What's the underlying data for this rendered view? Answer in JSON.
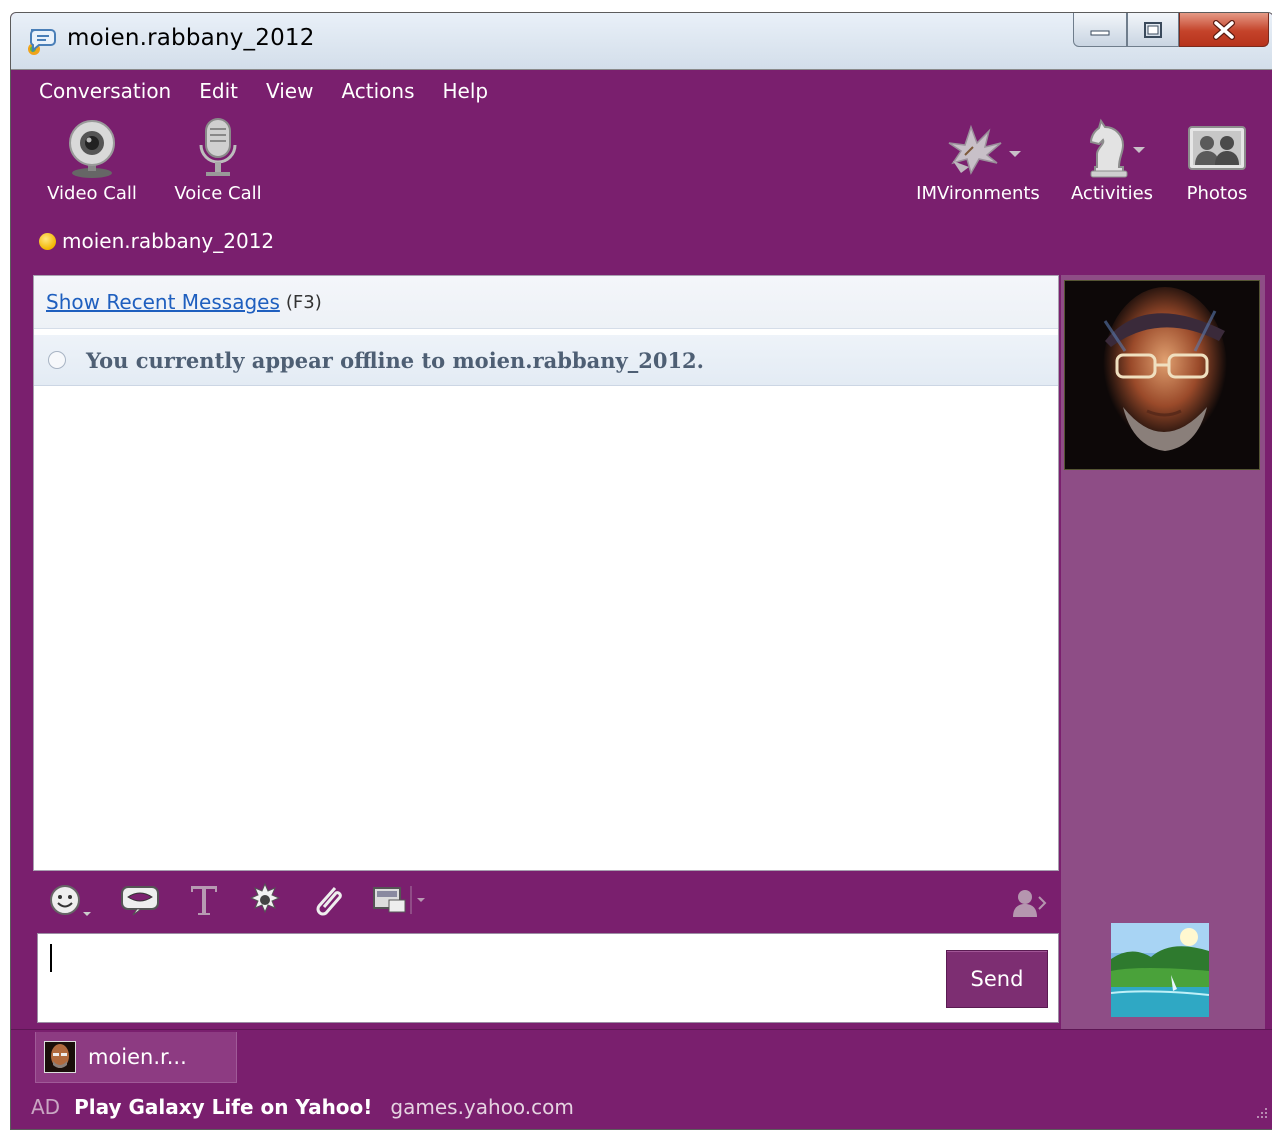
{
  "window": {
    "title": "moien.rabbany_2012"
  },
  "menu": {
    "items": [
      "Conversation",
      "Edit",
      "View",
      "Actions",
      "Help"
    ]
  },
  "toolbar": {
    "video_call": "Video Call",
    "voice_call": "Voice Call",
    "imvironments": "IMVironments",
    "activities": "Activities",
    "photos": "Photos"
  },
  "contact": {
    "name": "moien.rabbany_2012",
    "status_color": "#f2b600"
  },
  "conversation": {
    "recent_link": "Show Recent Messages",
    "recent_shortcut": "(F3)",
    "offline_notice": "You currently appear offline to moien.rabbany_2012."
  },
  "composer": {
    "send_label": "Send",
    "value": ""
  },
  "tabs": [
    {
      "label": "moien.r..."
    }
  ],
  "ad": {
    "tag": "AD",
    "title": "Play Galaxy Life on Yahoo!",
    "url": "games.yahoo.com"
  },
  "colors": {
    "accent": "#7a1f6e",
    "side_panel": "#8e4d86",
    "link": "#1f5fbf"
  },
  "icons": {
    "app": "yahoo-messenger-bubble-icon",
    "video": "webcam-icon",
    "voice": "microphone-icon",
    "imvironments": "leaves-icon",
    "activities": "chess-knight-icon",
    "photos": "photos-icon"
  }
}
